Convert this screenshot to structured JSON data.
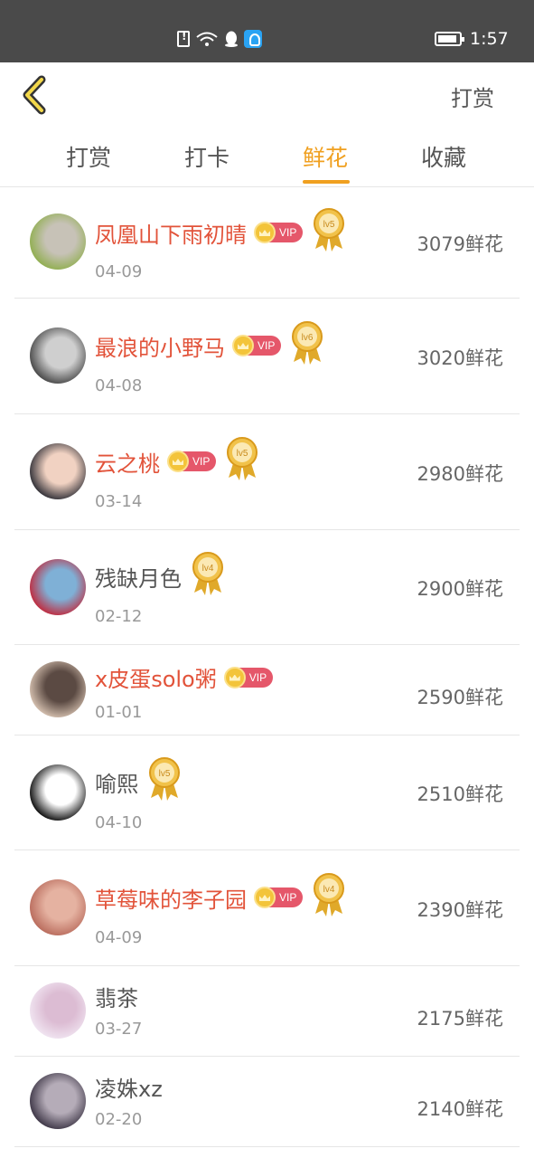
{
  "status_bar": {
    "time": "1:57",
    "icons": [
      "sim-alert-icon",
      "wifi-icon",
      "qq-icon",
      "app-notification-icon",
      "battery-icon"
    ]
  },
  "header": {
    "back_icon": "chevron-left-icon",
    "action_label": "打赏"
  },
  "tabs": [
    {
      "label": "打赏",
      "active": false
    },
    {
      "label": "打卡",
      "active": false
    },
    {
      "label": "鲜花",
      "active": true
    },
    {
      "label": "收藏",
      "active": false
    }
  ],
  "colors": {
    "accent": "#f0a020",
    "vip_name": "#e2533a",
    "vip_badge": "#e5576a",
    "text": "#555555",
    "muted": "#999999"
  },
  "vip_label": "VIP",
  "ranking": [
    {
      "name": "凤凰山下雨初晴",
      "vip": true,
      "level": "lv5",
      "date": "04-09",
      "amount": "3079鲜花"
    },
    {
      "name": "最浪的小野马",
      "vip": true,
      "level": "lv6",
      "date": "04-08",
      "amount": "3020鲜花"
    },
    {
      "name": "云之桃",
      "vip": true,
      "level": "lv5",
      "date": "03-14",
      "amount": "2980鲜花"
    },
    {
      "name": "残缺月色",
      "vip": false,
      "level": "lv4",
      "date": "02-12",
      "amount": "2900鲜花"
    },
    {
      "name": "x皮蛋solo粥",
      "vip": true,
      "level": null,
      "date": "01-01",
      "amount": "2590鲜花"
    },
    {
      "name": "喻熙",
      "vip": false,
      "level": "lv5",
      "date": "04-10",
      "amount": "2510鲜花"
    },
    {
      "name": "草莓味的李子园",
      "vip": true,
      "level": "lv4",
      "date": "04-09",
      "amount": "2390鲜花"
    },
    {
      "name": "翡茶",
      "vip": false,
      "level": null,
      "date": "03-27",
      "amount": "2175鲜花"
    },
    {
      "name": "凌姝xz",
      "vip": false,
      "level": null,
      "date": "02-20",
      "amount": "2140鲜花"
    }
  ]
}
